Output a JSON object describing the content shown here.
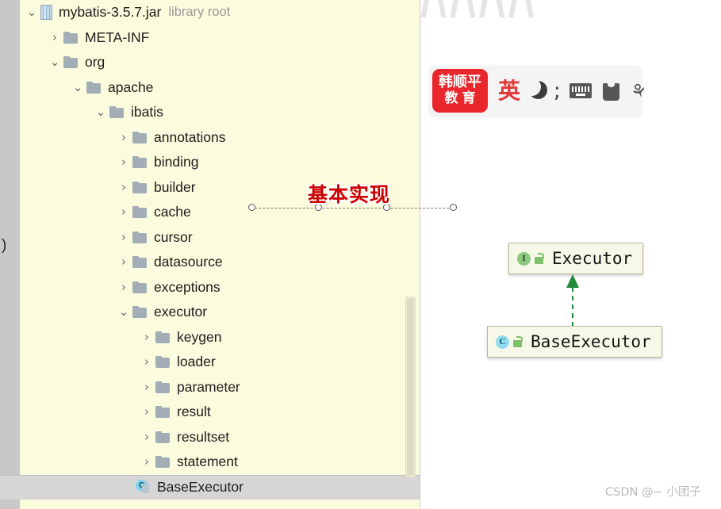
{
  "watermarks": {
    "top_pattern_glyphs": "/\\/\\/\\/\\",
    "csdn": "CSDN @~ 小团子"
  },
  "tree_panel": {
    "left_edge_fragment": ")",
    "scrollbar": {
      "name": "vertical-scrollbar"
    },
    "rows": [
      {
        "twisty": "⌄",
        "icon": "jar-icon",
        "indent": 0,
        "label": "mybatis-3.5.7.jar",
        "suffix": "library root",
        "selected": false
      },
      {
        "twisty": "›",
        "icon": "folder-icon",
        "indent": 1,
        "label": "META-INF",
        "suffix": "",
        "selected": false
      },
      {
        "twisty": "⌄",
        "icon": "folder-icon",
        "indent": 1,
        "label": "org",
        "suffix": "",
        "selected": false
      },
      {
        "twisty": "⌄",
        "icon": "folder-icon",
        "indent": 2,
        "label": "apache",
        "suffix": "",
        "selected": false
      },
      {
        "twisty": "⌄",
        "icon": "folder-icon",
        "indent": 3,
        "label": "ibatis",
        "suffix": "",
        "selected": false
      },
      {
        "twisty": "›",
        "icon": "folder-icon",
        "indent": 4,
        "label": "annotations",
        "suffix": "",
        "selected": false
      },
      {
        "twisty": "›",
        "icon": "folder-icon",
        "indent": 4,
        "label": "binding",
        "suffix": "",
        "selected": false
      },
      {
        "twisty": "›",
        "icon": "folder-icon",
        "indent": 4,
        "label": "builder",
        "suffix": "",
        "selected": false
      },
      {
        "twisty": "›",
        "icon": "folder-icon",
        "indent": 4,
        "label": "cache",
        "suffix": "",
        "selected": false
      },
      {
        "twisty": "›",
        "icon": "folder-icon",
        "indent": 4,
        "label": "cursor",
        "suffix": "",
        "selected": false
      },
      {
        "twisty": "›",
        "icon": "folder-icon",
        "indent": 4,
        "label": "datasource",
        "suffix": "",
        "selected": false
      },
      {
        "twisty": "›",
        "icon": "folder-icon",
        "indent": 4,
        "label": "exceptions",
        "suffix": "",
        "selected": false
      },
      {
        "twisty": "⌄",
        "icon": "folder-icon",
        "indent": 4,
        "label": "executor",
        "suffix": "",
        "selected": false
      },
      {
        "twisty": "›",
        "icon": "folder-icon",
        "indent": 5,
        "label": "keygen",
        "suffix": "",
        "selected": false
      },
      {
        "twisty": "›",
        "icon": "folder-icon",
        "indent": 5,
        "label": "loader",
        "suffix": "",
        "selected": false
      },
      {
        "twisty": "›",
        "icon": "folder-icon",
        "indent": 5,
        "label": "parameter",
        "suffix": "",
        "selected": false
      },
      {
        "twisty": "›",
        "icon": "folder-icon",
        "indent": 5,
        "label": "result",
        "suffix": "",
        "selected": false
      },
      {
        "twisty": "›",
        "icon": "folder-icon",
        "indent": 5,
        "label": "resultset",
        "suffix": "",
        "selected": false
      },
      {
        "twisty": "›",
        "icon": "folder-icon",
        "indent": 5,
        "label": "statement",
        "suffix": "",
        "selected": false
      },
      {
        "twisty": "",
        "icon": "class-icon",
        "indent": 5,
        "label": "BaseExecutor",
        "suffix": "",
        "selected": true
      }
    ]
  },
  "annotation": {
    "label": "基本实现",
    "connector": {
      "name": "dashed-connector-line",
      "handle_count": 4
    }
  },
  "ime_toolbar": {
    "logo": {
      "line1": "韩顺平",
      "line2": "教育"
    },
    "items": [
      {
        "name": "language-mode-button",
        "label": "英"
      },
      {
        "name": "moon-icon",
        "label": ""
      },
      {
        "name": "punctuation-mode-button",
        "label": ";"
      },
      {
        "name": "soft-keyboard-icon",
        "label": ""
      },
      {
        "name": "skin-icon",
        "label": ""
      },
      {
        "name": "settings-wrench-icon",
        "label": "⚘"
      }
    ]
  },
  "uml_diagram": {
    "nodes": [
      {
        "name": "uml-node-executor",
        "kind_badge": "I",
        "kind": "interface",
        "label": "Executor"
      },
      {
        "name": "uml-node-baseexecutor",
        "kind_badge": "C",
        "kind": "class",
        "label": "BaseExecutor"
      }
    ],
    "relation": {
      "name": "implements-arrow",
      "type": "implements",
      "from": "BaseExecutor",
      "to": "Executor",
      "color": "#1f8a38"
    }
  },
  "colors": {
    "tree_background": "#fbfbdd",
    "tree_selected_row": "#d6d6d6",
    "annotation_red": "#cc0000",
    "ime_logo_red": "#e8262b",
    "uml_box_fill": "#f8f8e8",
    "uml_arrow_green": "#1f8a38"
  }
}
